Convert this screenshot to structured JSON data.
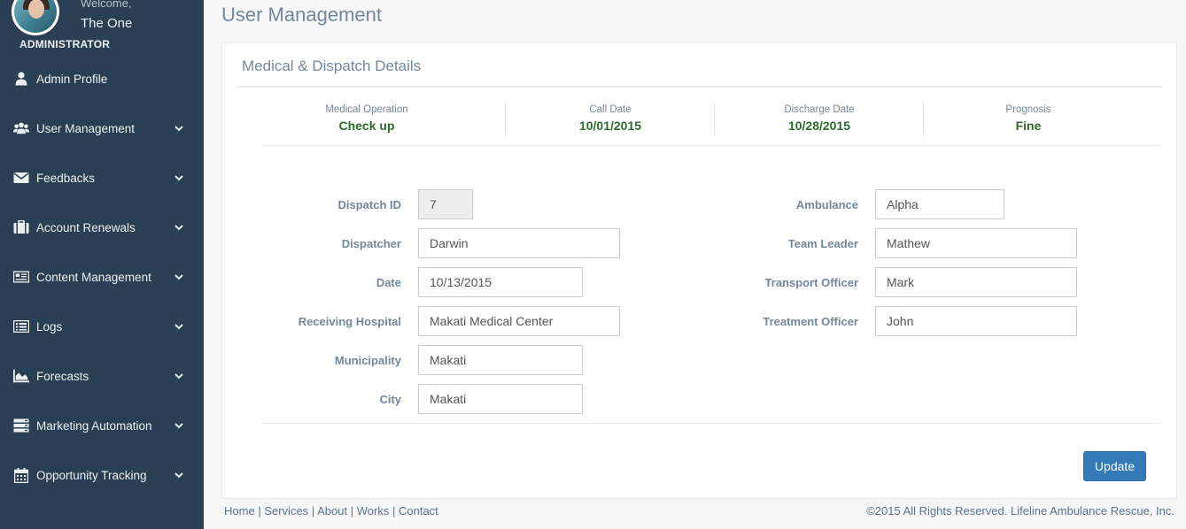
{
  "sidebar": {
    "welcome": "Welcome,",
    "username": "The One",
    "role": "ADMINISTRATOR",
    "items": [
      {
        "label": "Admin Profile",
        "icon": "user-icon",
        "has_chevron": false
      },
      {
        "label": "User Management",
        "icon": "users-icon",
        "has_chevron": true
      },
      {
        "label": "Feedbacks",
        "icon": "envelope-icon",
        "has_chevron": true
      },
      {
        "label": "Account Renewals",
        "icon": "briefcase-icon",
        "has_chevron": true
      },
      {
        "label": "Content Management",
        "icon": "newspaper-icon",
        "has_chevron": true
      },
      {
        "label": "Logs",
        "icon": "list-icon",
        "has_chevron": true
      },
      {
        "label": "Forecasts",
        "icon": "area-chart-icon",
        "has_chevron": true
      },
      {
        "label": "Marketing Automation",
        "icon": "server-icon",
        "has_chevron": true
      },
      {
        "label": "Opportunity Tracking",
        "icon": "calendar-icon",
        "has_chevron": true
      }
    ]
  },
  "page": {
    "title": "User Management"
  },
  "panel": {
    "title": "Medical & Dispatch Details",
    "stats": [
      {
        "label": "Medical Operation",
        "value": "Check up"
      },
      {
        "label": "Call Date",
        "value": "10/01/2015"
      },
      {
        "label": "Discharge Date",
        "value": "10/28/2015"
      },
      {
        "label": "Prognosis",
        "value": "Fine"
      }
    ],
    "form_left": [
      {
        "label": "Dispatch ID",
        "value": "7",
        "readonly": true
      },
      {
        "label": "Dispatcher",
        "value": "Darwin"
      },
      {
        "label": "Date",
        "value": "10/13/2015"
      },
      {
        "label": "Receiving Hospital",
        "value": "Makati Medical Center"
      },
      {
        "label": "Municipality",
        "value": "Makati"
      },
      {
        "label": "City",
        "value": "Makati"
      }
    ],
    "form_right": [
      {
        "label": "Ambulance",
        "value": "Alpha"
      },
      {
        "label": "Team Leader",
        "value": "Mathew"
      },
      {
        "label": "Transport Officer",
        "value": "Mark"
      },
      {
        "label": "Treatment Officer",
        "value": "John"
      }
    ],
    "update_label": "Update"
  },
  "footer": {
    "links": [
      "Home",
      "Services",
      "About",
      "Works",
      "Contact"
    ],
    "separator": "|",
    "copyright": "©2015 All Rights Reserved. Lifeline Ambulance Rescue, Inc."
  },
  "colors": {
    "sidebar_bg": "#2a3f54",
    "stat_value": "#2d6b2d",
    "primary_button": "#337ab7"
  }
}
